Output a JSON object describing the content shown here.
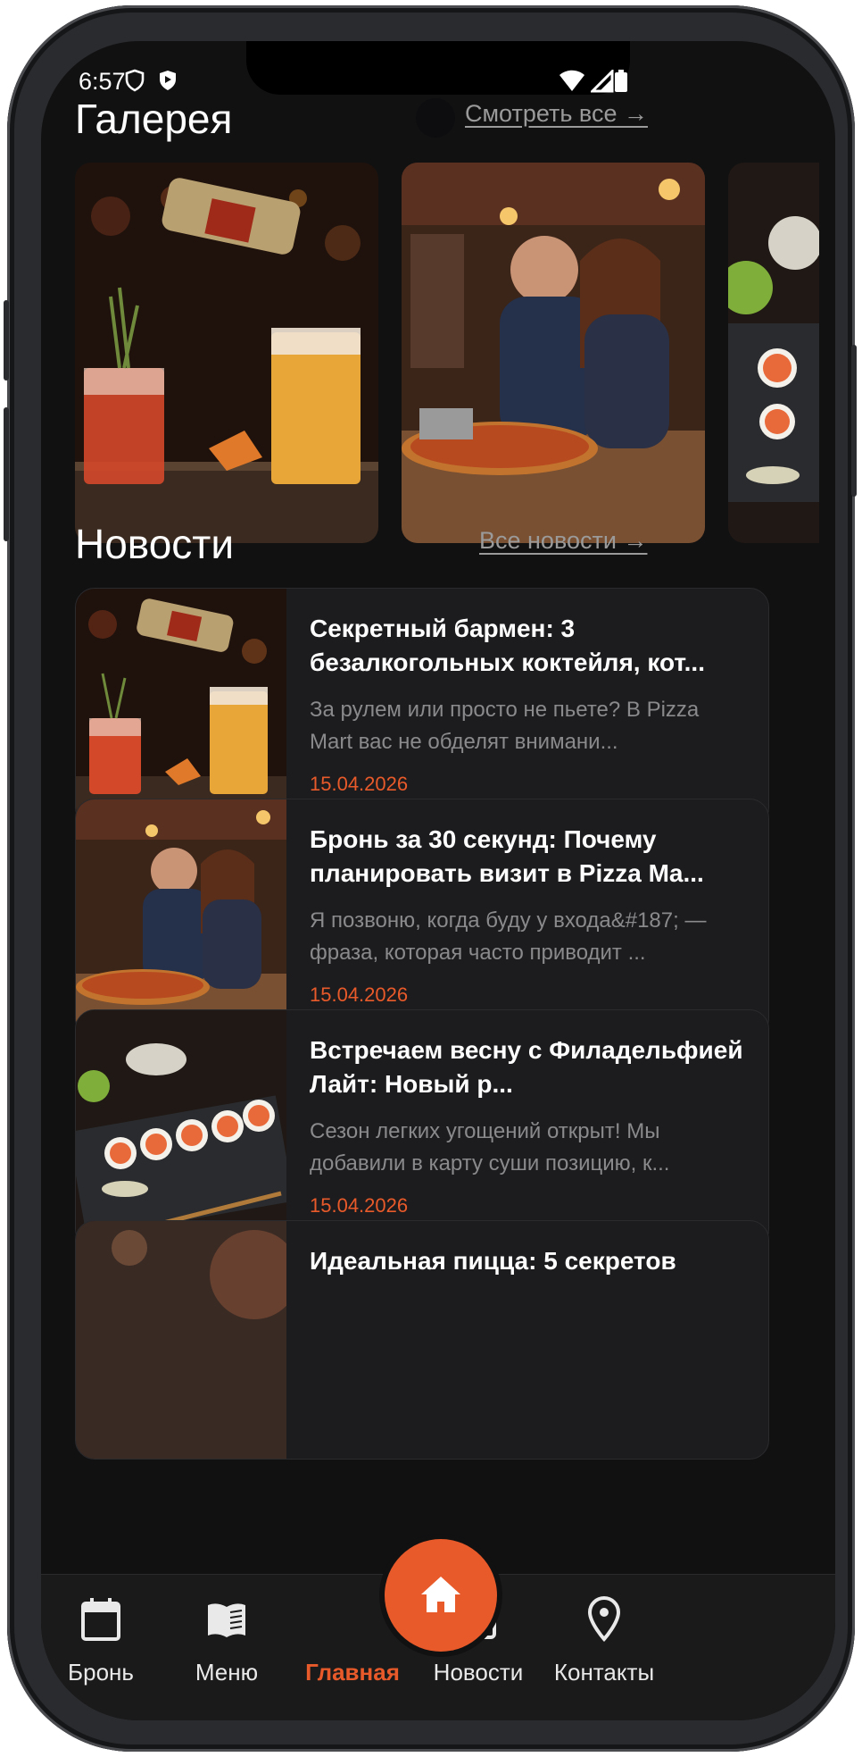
{
  "status_bar": {
    "time": "6:57"
  },
  "gallery": {
    "title": "Галерея",
    "see_all": "Смотреть все →",
    "images": [
      {
        "icon": "cocktails-photo"
      },
      {
        "icon": "couple-pizza-photo"
      },
      {
        "icon": "sushi-photo"
      }
    ]
  },
  "news": {
    "title": "Новости",
    "see_all": "Все новости →",
    "items": [
      {
        "title": "Секретный бармен: 3 безалкогольных коктейля, кот...",
        "desc": "За рулем или просто не пьете? В Pizza Mart вас не обделят внимани...",
        "date": "15.04.2026"
      },
      {
        "title": "Бронь за 30 секунд: Почему планировать визит в Pizza Ma...",
        "desc": "Я позвоню, когда буду у входа&#187; — фраза, которая часто приводит ...",
        "date": "15.04.2026"
      },
      {
        "title": "Встречаем весну с Филадельфией Лайт: Новый р...",
        "desc": "Сезон легких угощений открыт! Мы добавили в карту суши позицию, к...",
        "date": "15.04.2026"
      },
      {
        "title": "Идеальная пицца: 5 секретов",
        "desc": "",
        "date": ""
      }
    ]
  },
  "bottom_nav": {
    "items": [
      {
        "label": "Бронь",
        "icon": "calendar-icon"
      },
      {
        "label": "Меню",
        "icon": "book-icon"
      },
      {
        "label": "Главная",
        "icon": "home-icon",
        "active": true
      },
      {
        "label": "Новости",
        "icon": "news-icon"
      },
      {
        "label": "Контакты",
        "icon": "location-pin-icon"
      }
    ]
  },
  "colors": {
    "accent": "#e85a2a",
    "background": "#111112",
    "card": "#1c1c1e"
  }
}
